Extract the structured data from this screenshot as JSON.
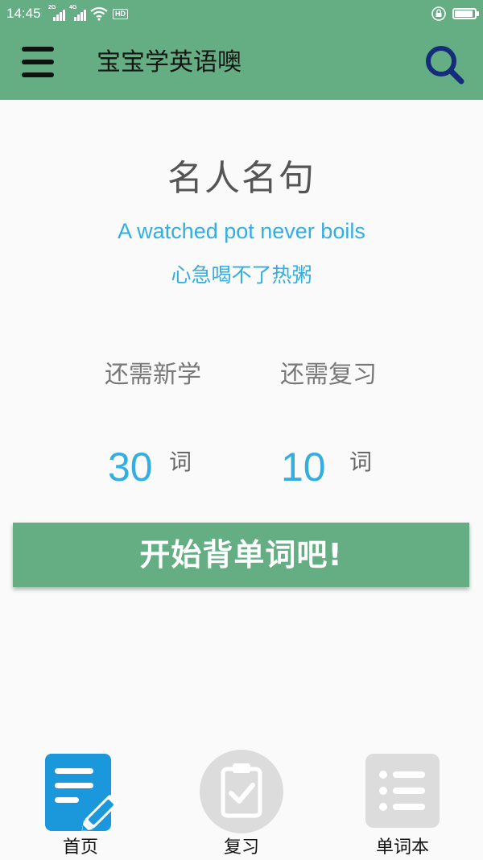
{
  "status_bar": {
    "time": "14:45",
    "network_tags": [
      "2G",
      "4G"
    ],
    "hd_label": "HD",
    "icons": [
      "signal-2g-icon",
      "signal-4g-icon",
      "wifi-icon",
      "hd-icon",
      "lock-icon",
      "battery-icon"
    ]
  },
  "app_bar": {
    "title": "宝宝学英语噢",
    "menu_icon": "hamburger-menu-icon",
    "search_icon": "search-icon"
  },
  "quote": {
    "heading": "名人名句",
    "english": "A watched pot never boils",
    "chinese": "心急喝不了热粥"
  },
  "stats": {
    "new": {
      "label": "还需新学",
      "value": "30",
      "unit": "词"
    },
    "review": {
      "label": "还需复习",
      "value": "10",
      "unit": "词"
    }
  },
  "start_button": {
    "label": "开始背单词吧!"
  },
  "bottom_nav": {
    "items": [
      {
        "label": "首页",
        "icon": "edit-document-icon",
        "active": true
      },
      {
        "label": "复习",
        "icon": "clipboard-check-icon",
        "active": false
      },
      {
        "label": "单词本",
        "icon": "list-icon",
        "active": false
      }
    ]
  },
  "colors": {
    "primary_green": "#65ae84",
    "accent_blue": "#33aee0",
    "active_nav_blue": "#1b97dc",
    "inactive_gray": "#dcdcdc"
  }
}
